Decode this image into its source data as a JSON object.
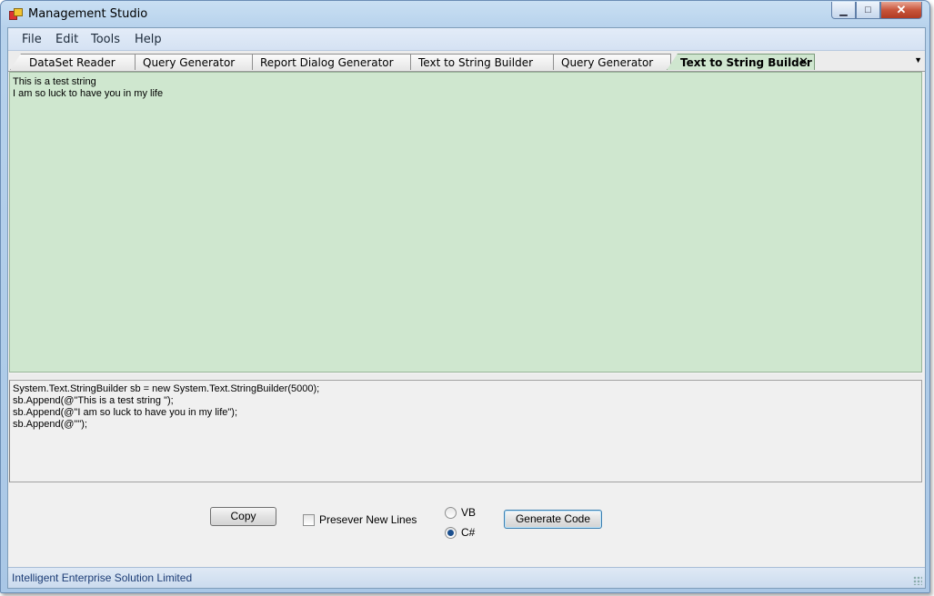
{
  "window": {
    "title": "Management Studio"
  },
  "menu": {
    "items": [
      "File",
      "Edit",
      "Tools",
      "Help"
    ]
  },
  "tabs": [
    {
      "label": "DataSet Reader"
    },
    {
      "label": "Query Generator"
    },
    {
      "label": "Report Dialog Generator"
    },
    {
      "label": "Text to String Builder"
    },
    {
      "label": "Query Generator"
    },
    {
      "label": "Text to String Builder",
      "active": true
    }
  ],
  "editor": {
    "input_text": "This is a test string\nI am so luck to have you in my life",
    "output_text": "System.Text.StringBuilder sb = new System.Text.StringBuilder(5000);\nsb.Append(@\"This is a test string \");\nsb.Append(@\"I am so luck to have you in my life\");\nsb.Append(@\"\");"
  },
  "controls": {
    "copy_label": "Copy",
    "preserve_label": "Presever New Lines",
    "preserve_checked": false,
    "vb_label": "VB",
    "cs_label": "C#",
    "selected_language": "C#",
    "generate_label": "Generate Code"
  },
  "statusbar": {
    "text": "Intelligent Enterprise Solution Limited"
  },
  "icons": {
    "app": "app-icon",
    "minimize": "minimize-icon",
    "maximize": "maximize-icon",
    "close": "close-icon",
    "tab_close": "close-icon",
    "tab_dropdown": "chevron-down-icon",
    "grip": "resize-grip-icon"
  },
  "colors": {
    "input_background": "#cfe7cf",
    "active_tab": "#cfe6cf",
    "status_text": "#1c3c75"
  }
}
